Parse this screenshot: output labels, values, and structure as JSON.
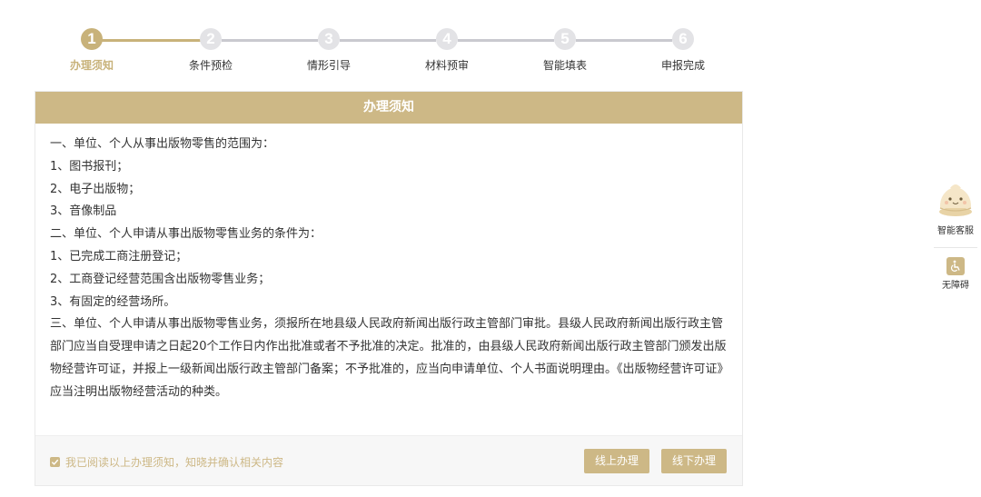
{
  "stepper": {
    "steps": [
      {
        "num": "1",
        "label": "办理须知"
      },
      {
        "num": "2",
        "label": "条件预检"
      },
      {
        "num": "3",
        "label": "情形引导"
      },
      {
        "num": "4",
        "label": "材料预审"
      },
      {
        "num": "5",
        "label": "智能填表"
      },
      {
        "num": "6",
        "label": "申报完成"
      }
    ],
    "active_index": 0
  },
  "card": {
    "title": "办理须知",
    "paragraphs": [
      "一、单位、个人从事出版物零售的范围为：",
      "1、图书报刊；",
      "2、电子出版物；",
      "3、音像制品",
      "二、单位、个人申请从事出版物零售业务的条件为：",
      "1、已完成工商注册登记；",
      "2、工商登记经营范围含出版物零售业务；",
      "3、有固定的经营场所。",
      "三、单位、个人申请从事出版物零售业务，须报所在地县级人民政府新闻出版行政主管部门审批。县级人民政府新闻出版行政主管部门应当自受理申请之日起20个工作日内作出批准或者不予批准的决定。批准的，由县级人民政府新闻出版行政主管部门颁发出版物经营许可证，并报上一级新闻出版行政主管部门备案；不予批准的，应当向申请单位、个人书面说明理由。《出版物经营许可证》应当注明出版物经营活动的种类。"
    ],
    "agree_text": "我已阅读以上办理须知，知晓并确认相关内容",
    "agree_checked": true,
    "online_button": "线上办理",
    "offline_button": "线下办理"
  },
  "float": {
    "service_label": "智能客服",
    "accessibility_label": "无障碍"
  },
  "colors": {
    "accent": "#cdb886",
    "step_inactive": "#e3e3e6"
  }
}
